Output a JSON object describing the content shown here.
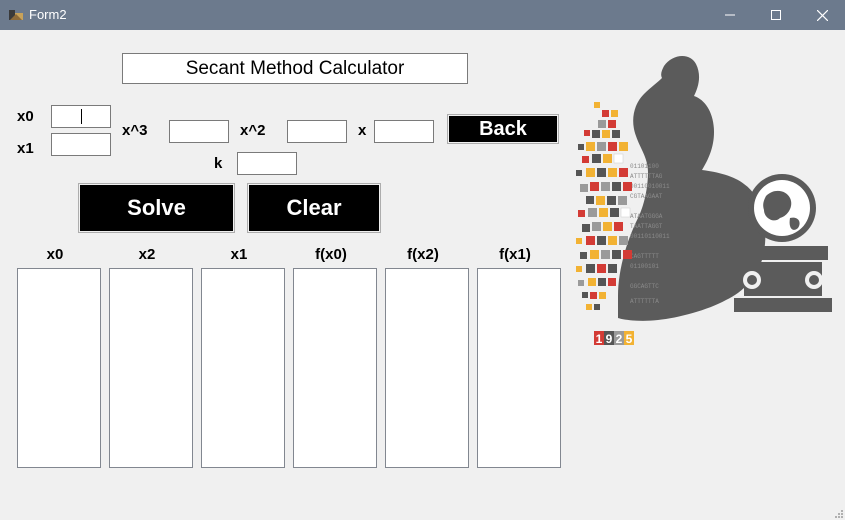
{
  "window": {
    "title": "Form2",
    "minimize_icon": "minimize-icon",
    "maximize_icon": "maximize-icon",
    "close_icon": "close-icon",
    "titlebar_color": "#6c7a8d"
  },
  "calculator": {
    "heading": "Secant Method Calculator",
    "inputs": {
      "x0_label": "x0",
      "x1_label": "x1",
      "x3_label": "x^3",
      "x2_label": "x^2",
      "x_label": "x",
      "k_label": "k",
      "x0_value": "",
      "x1_value": "",
      "x3_value": "",
      "x2_value": "",
      "x_value": "",
      "k_value": ""
    },
    "buttons": {
      "back": "Back",
      "solve": "Solve",
      "clear": "Clear"
    },
    "columns": [
      "x0",
      "x2",
      "x1",
      "f(x0)",
      "f(x2)",
      "f(x1)"
    ]
  },
  "logo": {
    "icon": "university-logo-icon",
    "digits": [
      "1",
      "9",
      "2",
      "5"
    ]
  }
}
